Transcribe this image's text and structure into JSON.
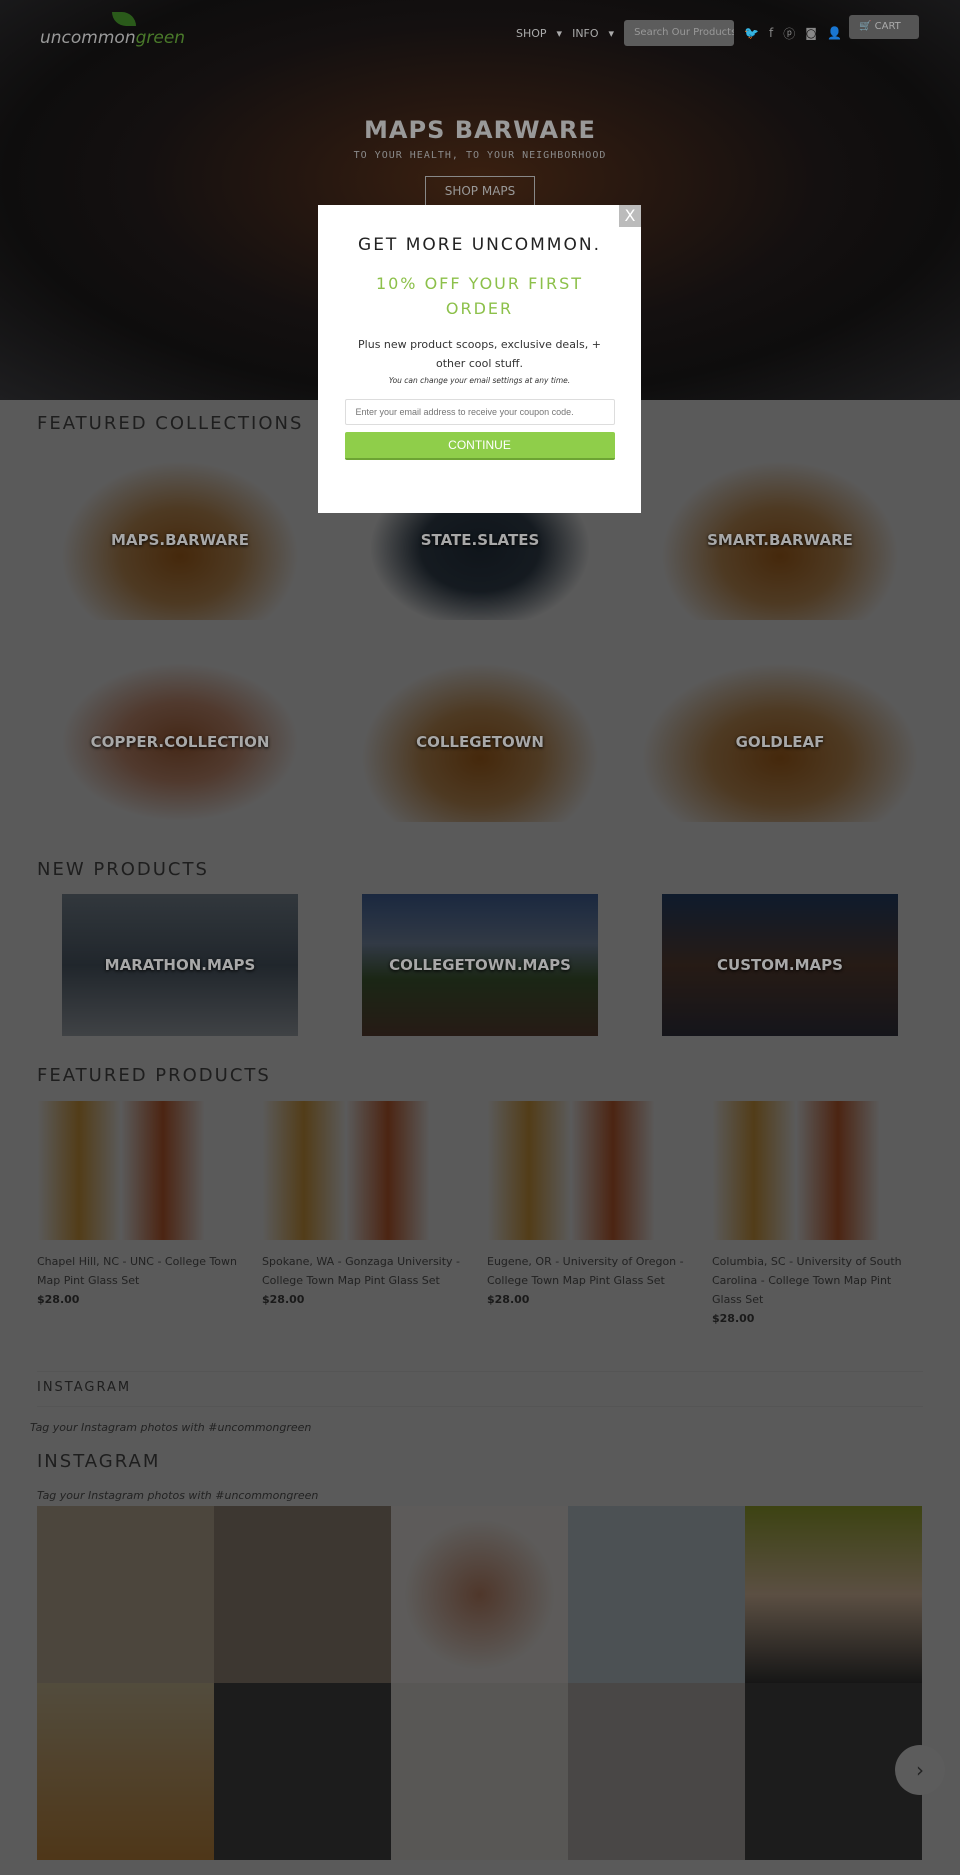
{
  "header": {
    "logo_a": "uncommon",
    "logo_b": "green",
    "nav": [
      "SHOP",
      "INFO"
    ],
    "search_placeholder": "Search Our Products...",
    "cart": "CART",
    "social": [
      "twitter-icon",
      "facebook-icon",
      "pinterest-icon",
      "instagram-icon",
      "user-icon"
    ]
  },
  "hero": {
    "title": "MAPS BARWARE",
    "subtitle": "TO YOUR HEALTH, TO YOUR NEIGHBORHOOD",
    "button": "SHOP MAPS"
  },
  "featured_collections": {
    "title": "FEATURED COLLECTIONS",
    "items": [
      "MAPS.BARWARE",
      "STATE.SLATES",
      "SMART.BARWARE",
      "COPPER.COLLECTION",
      "COLLEGETOWN",
      "GOLDLEAF"
    ]
  },
  "new_products": {
    "title": "NEW PRODUCTS",
    "items": [
      "MARATHON.MAPS",
      "COLLEGETOWN.MAPS",
      "CUSTOM.MAPS"
    ]
  },
  "featured_products": {
    "title": "FEATURED PRODUCTS",
    "items": [
      {
        "name": "Chapel Hill, NC - UNC - College Town Map Pint Glass Set",
        "price": "$28.00"
      },
      {
        "name": "Spokane, WA - Gonzaga University - College Town Map Pint Glass Set",
        "price": "$28.00"
      },
      {
        "name": "Eugene, OR - University of Oregon - College Town Map Pint Glass Set",
        "price": "$28.00"
      },
      {
        "name": "Columbia, SC - University of South Carolina - College Town Map Pint Glass Set",
        "price": "$28.00"
      }
    ]
  },
  "instagram": {
    "title_small": "INSTAGRAM",
    "tag_small": "Tag your Instagram photos with #uncommongreen",
    "title": "INSTAGRAM",
    "tag": "Tag your Instagram photos with #uncommongreen",
    "next": "›"
  },
  "modal": {
    "close": "X",
    "title": "GET MORE UNCOMMON.",
    "offer": "10% OFF YOUR FIRST ORDER",
    "body": "Plus new product scoops, exclusive deals, + other cool stuff.",
    "note": "You can change your email settings at any time.",
    "email_placeholder": "Enter your email address to receive your coupon code.",
    "button": "CONTINUE"
  },
  "colors": {
    "accent": "#8fce4a",
    "offer": "#8cc04a"
  }
}
